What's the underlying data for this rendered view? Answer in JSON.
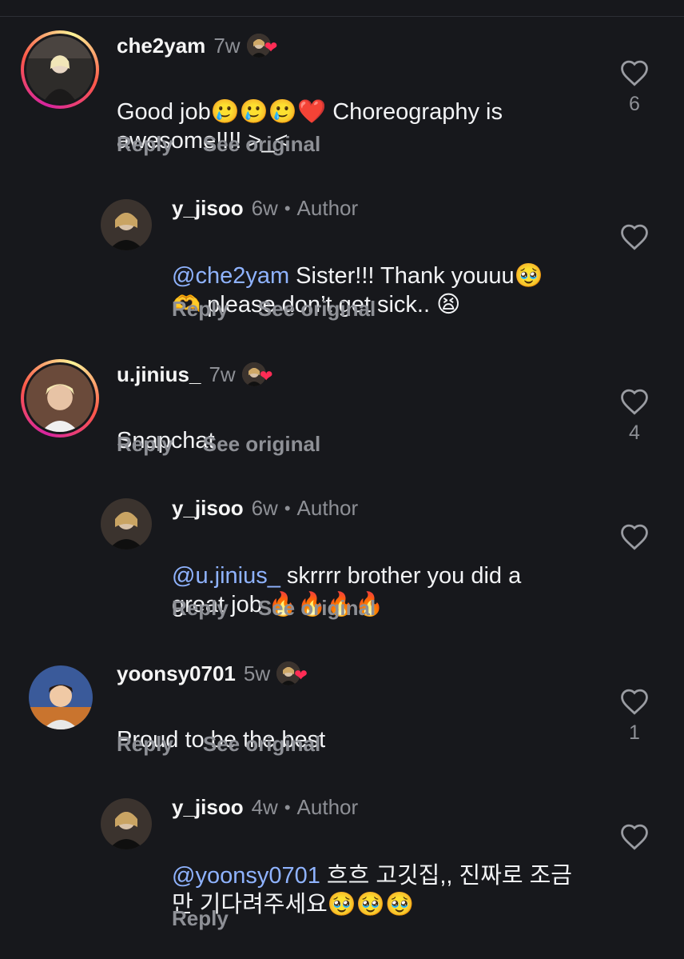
{
  "comments": [
    {
      "username": "che2yam",
      "time": "7w",
      "text": "Good job🥲🥲🥲❤️ Choreography is\nawesome!!!! >_<",
      "mention": "",
      "reply_label": "Reply",
      "see_label": "See original",
      "like_count": "6",
      "liked_by_author": true
    },
    {
      "username": "y_jisoo",
      "time": "6w",
      "author_label": "Author",
      "mention": "@che2yam",
      "text": " Sister!!! Thank youuu🥹\n🫶 please don’t get sick.. 😫",
      "reply_label": "Reply",
      "see_label": "See original"
    },
    {
      "username": "u.jinius_",
      "time": "7w",
      "text": "Snapchat",
      "mention": "",
      "reply_label": "Reply",
      "see_label": "See original",
      "like_count": "4",
      "liked_by_author": true
    },
    {
      "username": "y_jisoo",
      "time": "6w",
      "author_label": "Author",
      "mention": "@u.jinius_",
      "text": " skrrrr brother you did a\ngreat job 🔥🔥🔥🔥",
      "reply_label": "Reply",
      "see_label": "See original"
    },
    {
      "username": "yoonsy0701",
      "time": "5w",
      "text": "Proud to be the best",
      "mention": "",
      "reply_label": "Reply",
      "see_label": "See original",
      "like_count": "1",
      "liked_by_author": true
    },
    {
      "username": "y_jisoo",
      "time": "4w",
      "author_label": "Author",
      "mention": "@yoonsy0701",
      "text": " 흐흐 고깃집,, 진짜로 조금\n만 기다려주세요🥹🥹🥹",
      "reply_label": "Reply"
    }
  ],
  "colors": {
    "background": "#17181c",
    "mention": "#8fb3ff",
    "muted": "#8e9096",
    "heart": "#ff2c55"
  },
  "icons": {
    "like": "heart-outline-icon",
    "liked_by_author": "heart-filled-icon"
  }
}
